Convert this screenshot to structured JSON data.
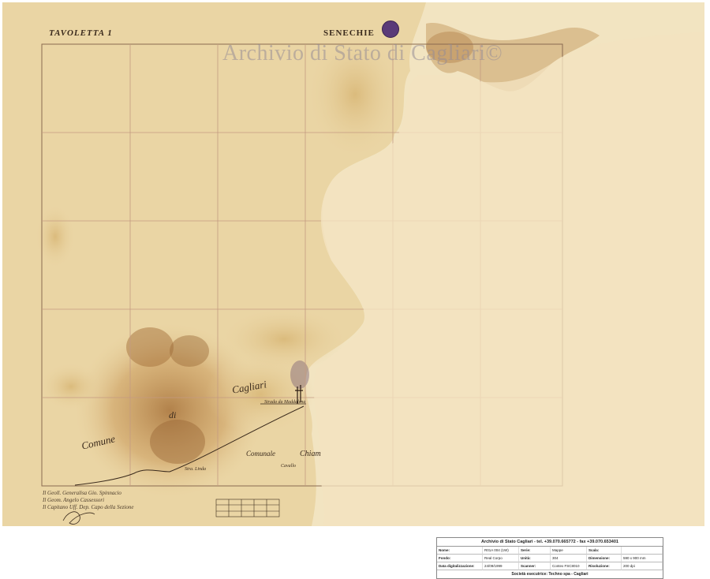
{
  "map": {
    "sheet_label": "TAVOLETTA 1",
    "region_label": "SENECHIE",
    "watermark": "Archivio di Stato di Cagliari©",
    "stamp_icon": "archive-seal-icon",
    "place_labels": {
      "comune": "Comune",
      "di": "di",
      "cagliari": "Cagliari",
      "comunale": "Comunale",
      "chiam": "Chiam",
      "road_upper": "Strada da Maddalena",
      "road_lower": "Stra. Linda",
      "small": "Cavallo"
    },
    "signatures": [
      "Il Geoll. Generalisa Gio. Spinnacio",
      "Il Geom. Angelo Cassessori",
      "Il Capitano Uff. Dep. Capo della Sezione"
    ]
  },
  "footer": {
    "title": "Archivio di Stato Cagliari - tel. +39.070.665772 - fax +39.070.653401",
    "rows": [
      [
        {
          "k": "Nome:"
        },
        {
          "v": "R01A 004 (1W)"
        },
        {
          "k": "Serie:"
        },
        {
          "v": "Mappe"
        },
        {
          "k": "Scala:"
        },
        {
          "v": ""
        }
      ],
      [
        {
          "k": "Fondo:"
        },
        {
          "v": "Real Corpo"
        },
        {
          "k": "Unità:"
        },
        {
          "v": "304"
        },
        {
          "k": "Dimensione:"
        },
        {
          "v": "590 x 900 mm"
        }
      ],
      [
        {
          "k": "Data digitalizzazione:"
        },
        {
          "v": "24/09/1999"
        },
        {
          "k": "Scanner:"
        },
        {
          "v": "Contex FSC8010"
        },
        {
          "k": "Risoluzione:"
        },
        {
          "v": "200 dpi"
        }
      ]
    ],
    "bottom": "Società esecutrice: Techno spa - Cagliari"
  },
  "colors": {
    "paper": "#eedcb3",
    "paper_light": "#f4e6c3",
    "stain": "#b8864a",
    "grid_line": "#c49a82",
    "ink": "#3a2a1c",
    "stamp": "#5a3a78"
  }
}
